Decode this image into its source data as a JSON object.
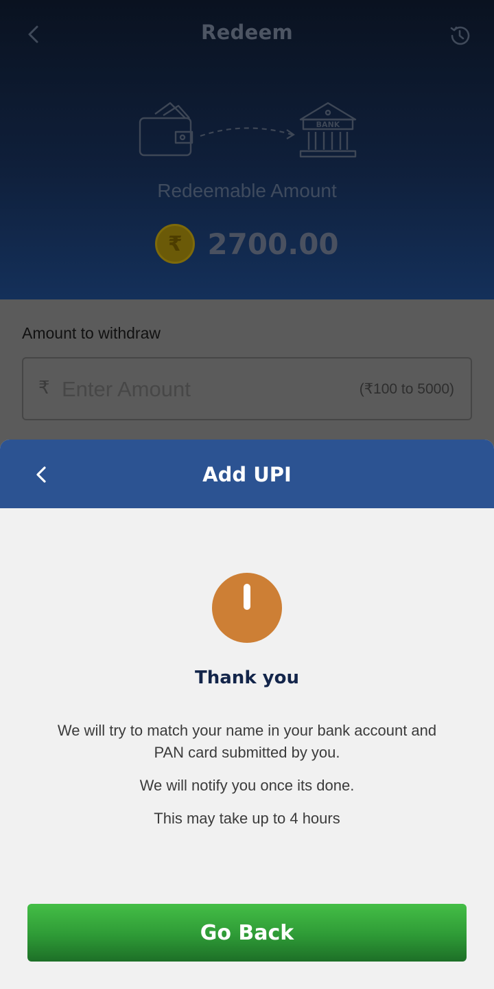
{
  "header": {
    "title": "Redeem",
    "back_icon": "chevron-left-icon",
    "history_icon": "history-icon"
  },
  "illustration": {
    "wallet_icon": "wallet-icon",
    "arrow_icon": "dashed-arrow-icon",
    "bank_icon": "bank-icon",
    "bank_label": "BANK"
  },
  "balance": {
    "label": "Redeemable Amount",
    "coin_symbol": "₹",
    "amount": "2700.00"
  },
  "withdraw": {
    "label": "Amount to withdraw",
    "currency_prefix": "₹",
    "placeholder": "Enter Amount",
    "range_hint": "(₹100 to 5000)"
  },
  "sheet": {
    "title": "Add UPI",
    "back_icon": "chevron-left-icon",
    "status_icon": "alert-icon",
    "heading": "Thank you",
    "message_1": "We will try to match your name in your bank account and PAN card submitted by you.",
    "message_2": "We will notify you once its done.",
    "message_3": "This may take up to 4 hours",
    "button_label": "Go Back"
  },
  "colors": {
    "sheet_header": "#2c5392",
    "alert": "#cd7f35",
    "button": "#2e9a36"
  }
}
